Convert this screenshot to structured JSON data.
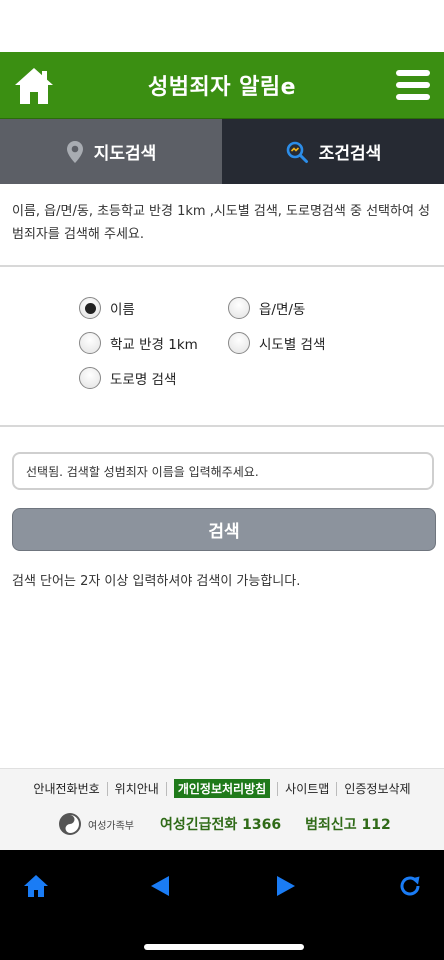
{
  "header": {
    "title": "성범죄자 알림e"
  },
  "tabs": [
    {
      "label": "지도검색",
      "icon": "map-pin-icon"
    },
    {
      "label": "조건검색",
      "icon": "search-icon"
    }
  ],
  "description": "이름, 읍/면/동, 초등학교 반경 1km ,시도별 검색, 도로명검색 중 선택하여 성범죄자를 검색해 주세요.",
  "search_options": [
    {
      "label": "이름",
      "checked": true
    },
    {
      "label": "읍/면/동",
      "checked": false
    },
    {
      "label": "학교 반경 1km",
      "checked": false
    },
    {
      "label": "시도별 검색",
      "checked": false
    },
    {
      "label": "도로명 검색",
      "checked": false
    }
  ],
  "search": {
    "placeholder": "선택됨. 검색할 성범죄자 이름을 입력해주세요.",
    "button_label": "검색",
    "hint": "검색 단어는 2자 이상 입력하셔야 검색이 가능합니다."
  },
  "footer": {
    "links": [
      "안내전화번호",
      "위치안내",
      "개인정보처리방침",
      "사이트맵",
      "인증정보삭제"
    ],
    "ministry": "여성가족부",
    "hotline": "여성긴급전화 1366",
    "report": "범죄신고 112"
  },
  "colors": {
    "brand_green": "#3b8f12",
    "tab_active": "#262a33",
    "tab_inactive": "#5c5f66",
    "nav_blue": "#1a7cf5"
  }
}
